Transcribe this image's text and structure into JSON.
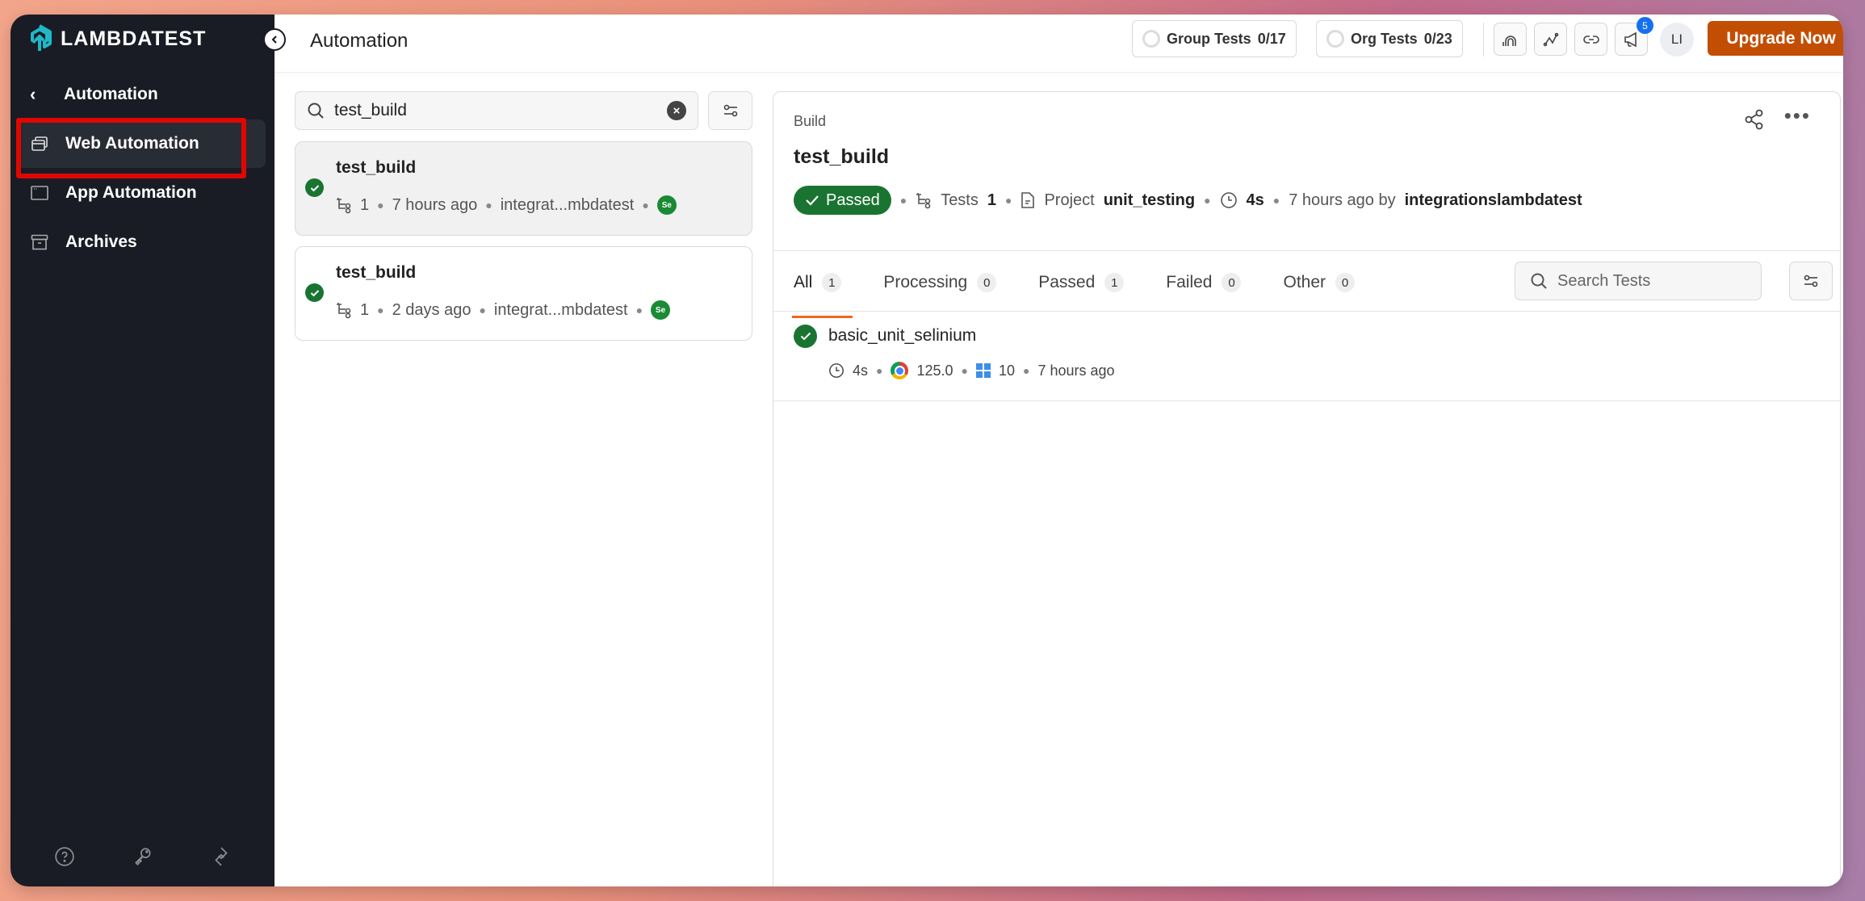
{
  "app": {
    "brand": "LAMBDATEST",
    "page_title": "Automation"
  },
  "sidebar": {
    "back_label": "Automation",
    "items": [
      {
        "label": "Web Automation",
        "icon": "windows-stack-icon",
        "active": true
      },
      {
        "label": "App Automation",
        "icon": "app-window-icon",
        "active": false
      },
      {
        "label": "Archives",
        "icon": "archive-icon",
        "active": false
      }
    ],
    "bottom_icons": [
      "help-icon",
      "key-icon",
      "integrations-icon"
    ]
  },
  "header": {
    "group_tests": {
      "label": "Group Tests",
      "value": "0/17"
    },
    "org_tests": {
      "label": "Org Tests",
      "value": "0/23"
    },
    "icon_buttons": [
      "rainbow-icon",
      "analytics-icon",
      "link-icon",
      "megaphone-icon"
    ],
    "notification_count": "5",
    "avatar_initials": "LI",
    "upgrade_label": "Upgrade Now"
  },
  "build_list": {
    "search_value": "test_build",
    "builds": [
      {
        "name": "test_build",
        "tests": "1",
        "time": "7 hours ago",
        "user": "integrat...mbdatest",
        "framework": "Se",
        "status": "passed",
        "selected": true
      },
      {
        "name": "test_build",
        "tests": "1",
        "time": "2 days ago",
        "user": "integrat...mbdatest",
        "framework": "Se",
        "status": "passed",
        "selected": false
      }
    ]
  },
  "build_detail": {
    "kicker": "Build",
    "title": "test_build",
    "status": "Passed",
    "tests_label": "Tests",
    "tests_value": "1",
    "project_label": "Project",
    "project_value": "unit_testing",
    "duration": "4s",
    "time_by": "7 hours ago by",
    "user": "integrationslambdatest",
    "tabs": [
      {
        "label": "All",
        "count": "1",
        "active": true
      },
      {
        "label": "Processing",
        "count": "0",
        "active": false
      },
      {
        "label": "Passed",
        "count": "1",
        "active": false
      },
      {
        "label": "Failed",
        "count": "0",
        "active": false
      },
      {
        "label": "Other",
        "count": "0",
        "active": false
      }
    ],
    "search_placeholder": "Search Tests",
    "tests": [
      {
        "name": "basic_unit_selinium",
        "duration": "4s",
        "browser_version": "125.0",
        "os_version": "10",
        "time": "7 hours ago",
        "status": "passed"
      }
    ]
  },
  "colors": {
    "accent": "#c24e04",
    "passed": "#1a7431",
    "sidebar_bg": "#191c24",
    "tab_underline": "#f26722",
    "highlight": "#e10600"
  }
}
